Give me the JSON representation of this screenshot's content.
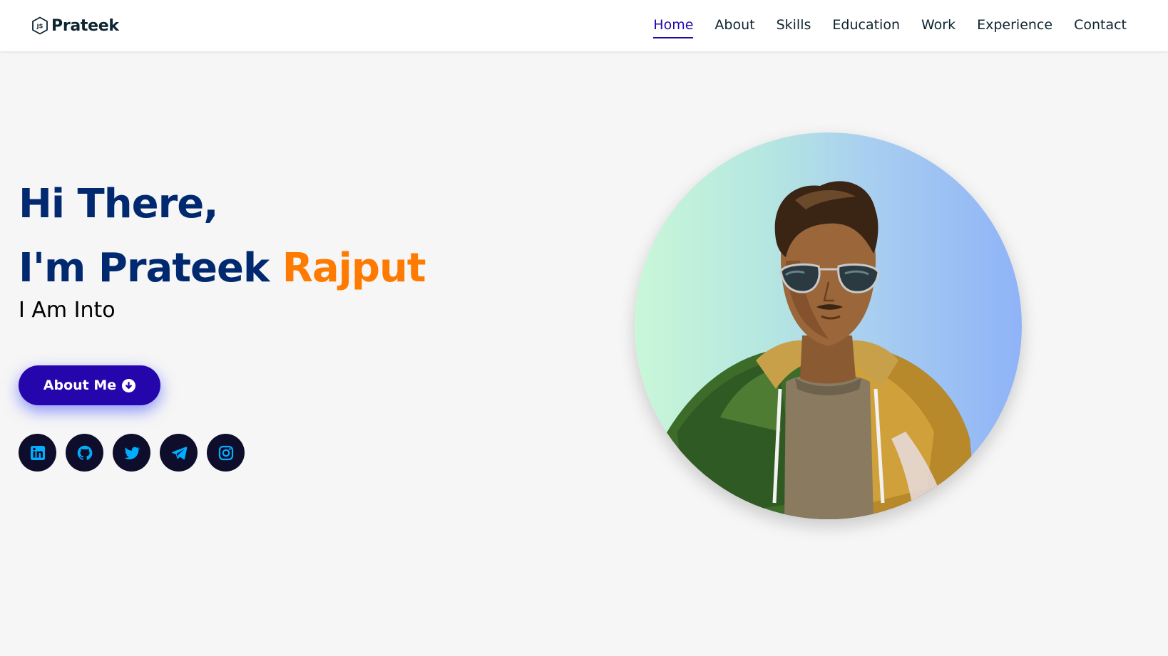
{
  "brand": {
    "name": "Prateek",
    "logo_icon": "js-hexagon-icon"
  },
  "nav": {
    "items": [
      {
        "label": "Home",
        "active": true
      },
      {
        "label": "About",
        "active": false
      },
      {
        "label": "Skills",
        "active": false
      },
      {
        "label": "Education",
        "active": false
      },
      {
        "label": "Work",
        "active": false
      },
      {
        "label": "Experience",
        "active": false
      },
      {
        "label": "Contact",
        "active": false
      }
    ]
  },
  "hero": {
    "greeting": "Hi There,",
    "name_prefix": "I'm Prateek ",
    "name_accent": "Rajput",
    "subtitle": "I Am Into",
    "button_label": "About Me",
    "button_icon": "arrow-circle-down-icon"
  },
  "socials": [
    {
      "name": "linkedin-icon"
    },
    {
      "name": "github-icon"
    },
    {
      "name": "twitter-icon"
    },
    {
      "name": "telegram-icon"
    },
    {
      "name": "instagram-icon"
    }
  ],
  "colors": {
    "primary": "#2506ad",
    "heading": "#012970",
    "accent": "#ff7a00",
    "social_bg": "#0e0e2c",
    "social_icon": "#00aeff",
    "background": "#f6f6f6"
  }
}
